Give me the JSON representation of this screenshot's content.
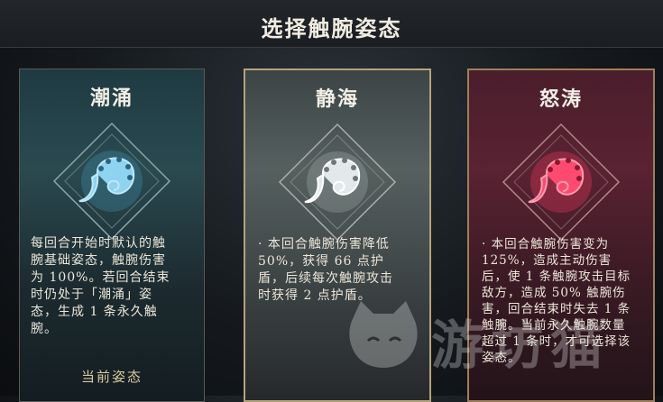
{
  "header": {
    "title": "选择触腕姿态"
  },
  "cards": [
    {
      "title": "潮涌",
      "icon": "tentacle-icon",
      "color": "#6fb8d8",
      "desc_lines": [
        "每回合开始时默认的触",
        "腕基础姿态，触腕伤害",
        "为 100%。若回合结束",
        "时仍处于「潮涌」姿",
        "态，生成 1 条永久触",
        "腕。"
      ],
      "status": "当前姿态"
    },
    {
      "title": "静海",
      "icon": "tentacle-icon",
      "color": "#d9dfe2",
      "desc_lines": [
        "· 本回合触腕伤害降低",
        "50%，获得 66 点护",
        "盾，后续每次触腕攻击",
        "时获得 2 点护盾。"
      ]
    },
    {
      "title": "怒涛",
      "icon": "tentacle-icon",
      "color": "#ff3b62",
      "desc_lines": [
        "· 本回合触腕伤害变为",
        "125%，造成主动伤害",
        "后，使 1 条触腕攻击目标",
        "敌方，造成 50% 触腕伤",
        "害，回合结束时失去 1 条",
        "触腕。当前永久触腕数量",
        "超过 1 条时，才可选择该",
        "姿态。"
      ]
    }
  ],
  "watermark": {
    "text": "游坊猫",
    "icon": "cat-logo-icon"
  }
}
